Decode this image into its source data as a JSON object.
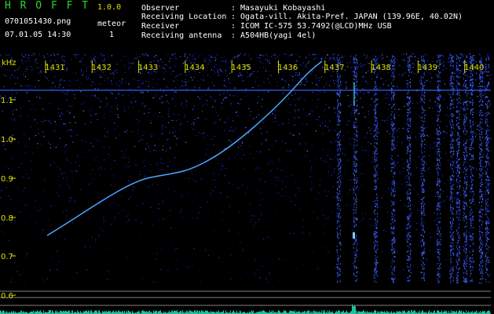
{
  "header": {
    "app_name": "H R O F F T",
    "version": "1.0.0",
    "filename": "0701051430.png",
    "datetime": "07.01.05 14:30",
    "meteor_label": "meteor",
    "meteor_count": "1",
    "observer_label": "Observer",
    "observer_value": ": Masayuki Kobayashi",
    "location_label": "Receiving Location",
    "location_value": ": Ogata-vill. Akita-Pref. JAPAN (139.96E, 40.02N)",
    "receiver_label": "Receiver",
    "receiver_value": ": ICOM IC-575 53.7492(@LCD)MHz USB",
    "antenna_label": "Receiving antenna",
    "antenna_value": ": A504HB(yagi 4el)"
  },
  "axis": {
    "unit": "kHz",
    "y_ticks": [
      "1.1",
      "1.0",
      "0.9",
      "0.8",
      "0.7",
      "0.6"
    ],
    "x_ticks": [
      "1431",
      "1432",
      "1433",
      "1434",
      "1435",
      "1436",
      "1437",
      "1438",
      "1439",
      "1440"
    ]
  },
  "colors": {
    "background": "#000000",
    "noise": "#1a30d8",
    "trace": "#4aa6ff",
    "tick_text": "#e0e000",
    "header_text": "#ffffff",
    "accent_green": "#2fd62f"
  }
}
